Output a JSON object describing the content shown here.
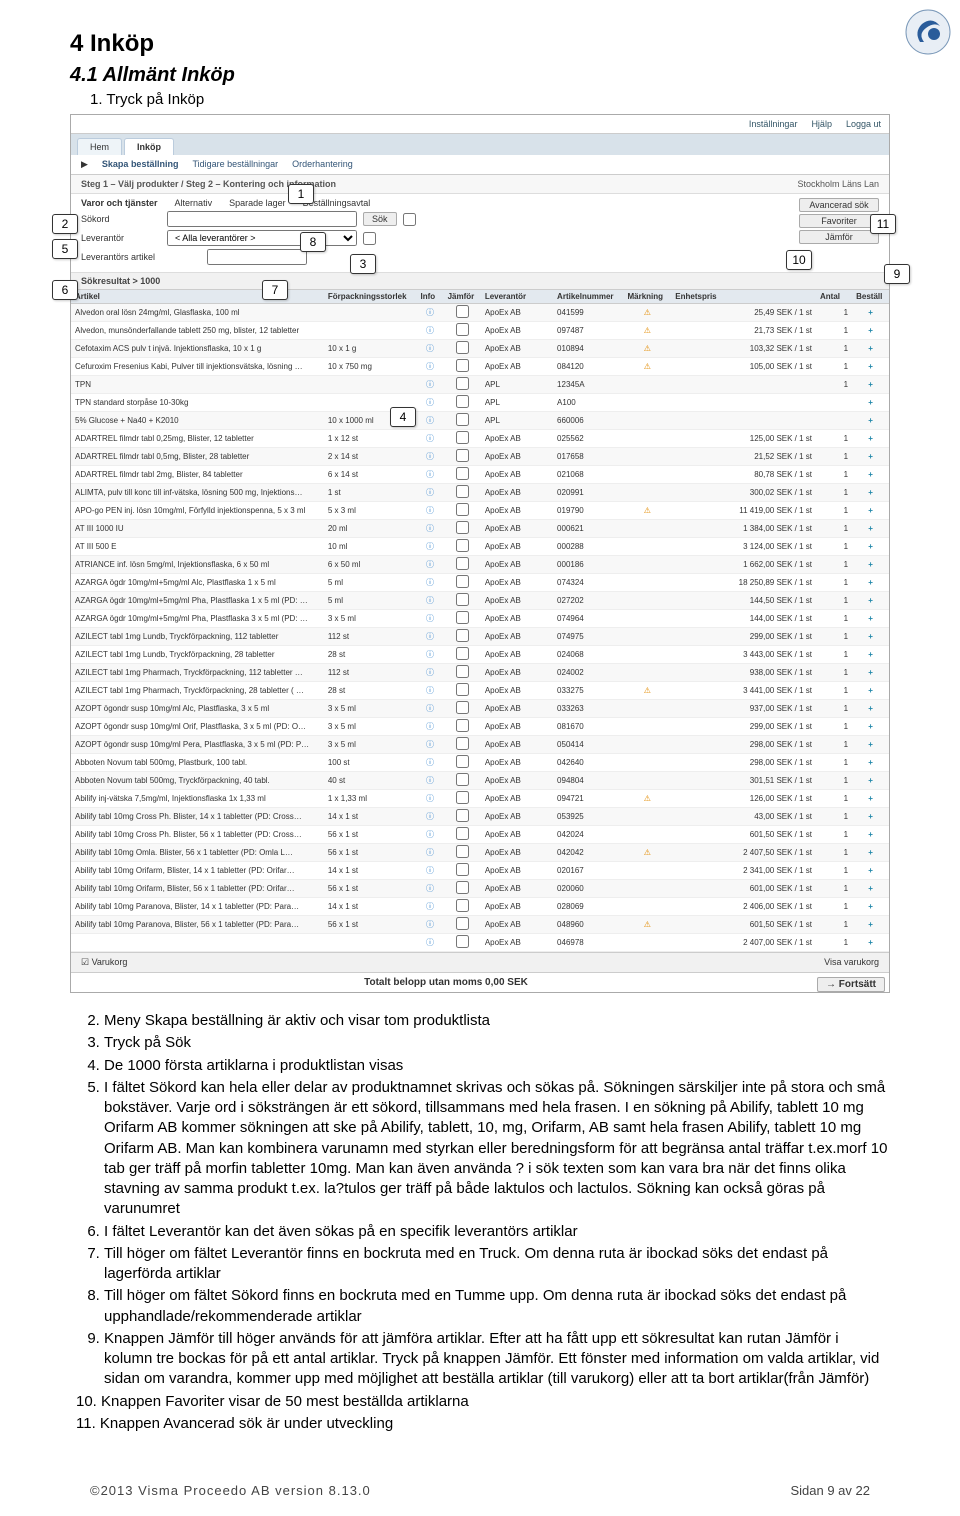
{
  "logo_color": "#2a5c9a",
  "heading": "4  Inköp",
  "subheading": "4.1  Allmänt Inköp",
  "intro": "1.  Tryck på Inköp",
  "callouts": [
    "1",
    "2",
    "3",
    "4",
    "5",
    "6",
    "7",
    "8",
    "9",
    "10",
    "11"
  ],
  "topbar": {
    "settings": "Inställningar",
    "help": "Hjälp",
    "logout": "Logga ut"
  },
  "tabs": {
    "hem": "Hem",
    "inkop": "Inköp"
  },
  "subtabs": {
    "skapa": "Skapa beställning",
    "tidigare": "Tidigare beställningar",
    "order": "Orderhantering"
  },
  "steps": "Steg 1 – Välj produkter / Steg 2 – Kontering och information",
  "rightpanel": {
    "region": "Stockholm Läns Lan",
    "adv": "Avancerad sök",
    "fav": "Favoriter",
    "cmp": "Jämför"
  },
  "filters": {
    "goods_label": "Varor och tjänster",
    "alt_label": "Alternativ",
    "spar_label": "Sparade lager",
    "best_label": "Beställningsavtal",
    "sokord_label": "Sökord",
    "sok_btn": "Sök",
    "lev_label": "Leverantör",
    "lev_value": "< Alla leverantörer >",
    "lev_art": "Leverantörs artikel"
  },
  "result_caption": "Sökresultat > 1000",
  "columns": {
    "art": "Artikel",
    "pack": "Förpackningsstorlek",
    "info": "Info",
    "cmp": "Jämför",
    "lev": "Leverantör",
    "num": "Artikelnummer",
    "mark": "Märkning",
    "unit": "Enhetspris",
    "price": "",
    "qty": "Antal",
    "add": "Beställ"
  },
  "rows": [
    {
      "art": "Alvedon oral lösn 24mg/ml, Glasflaska, 100 ml",
      "pack": "",
      "lev": "ApoEx AB",
      "num": "041599",
      "mark": "w",
      "price": "25,49 SEK / 1 st",
      "qty": "1"
    },
    {
      "art": "Alvedon, munsönderfallande tablett 250 mg, blister, 12 tabletter",
      "pack": "",
      "lev": "ApoEx AB",
      "num": "097487",
      "mark": "w",
      "price": "21,73 SEK / 1 st",
      "qty": "1"
    },
    {
      "art": "Cefotaxim ACS pulv t injvä. Injektionsflaska, 10 x 1 g",
      "pack": "10 x 1 g",
      "lev": "ApoEx AB",
      "num": "010894",
      "mark": "w",
      "price": "103,32 SEK / 1 st",
      "qty": "1"
    },
    {
      "art": "Cefuroxim Fresenius Kabi, Pulver till injektionsvätska, lösning …",
      "pack": "10 x 750 mg",
      "lev": "ApoEx AB",
      "num": "084120",
      "mark": "w",
      "price": "105,00 SEK / 1 st",
      "qty": "1"
    },
    {
      "art": "TPN",
      "pack": "",
      "lev": "APL",
      "num": "12345A",
      "mark": "",
      "price": "",
      "qty": "1"
    },
    {
      "art": "TPN standard storpåse 10-30kg",
      "pack": "",
      "lev": "APL",
      "num": "A100",
      "mark": "",
      "price": "",
      "qty": ""
    },
    {
      "art": "5% Glucose + Na40 + K2010",
      "pack": "10 x 1000 ml",
      "lev": "APL",
      "num": "660006",
      "mark": "",
      "price": "",
      "qty": ""
    },
    {
      "art": "ADARTREL filmdr tabl 0,25mg, Blister, 12 tabletter",
      "pack": "1 x 12 st",
      "lev": "ApoEx AB",
      "num": "025562",
      "mark": "",
      "price": "125,00 SEK / 1 st",
      "qty": "1"
    },
    {
      "art": "ADARTREL filmdr tabl 0,5mg, Blister, 28 tabletter",
      "pack": "2 x 14 st",
      "lev": "ApoEx AB",
      "num": "017658",
      "mark": "",
      "price": "21,52 SEK / 1 st",
      "qty": "1"
    },
    {
      "art": "ADARTREL filmdr tabl 2mg, Blister, 84 tabletter",
      "pack": "6 x 14 st",
      "lev": "ApoEx AB",
      "num": "021068",
      "mark": "",
      "price": "80,78 SEK / 1 st",
      "qty": "1"
    },
    {
      "art": "ALIMTA, pulv till konc till inf-vätska, lösning 500 mg, Injektions…",
      "pack": "1 st",
      "lev": "ApoEx AB",
      "num": "020991",
      "mark": "",
      "price": "300,02 SEK / 1 st",
      "qty": "1"
    },
    {
      "art": "APO-go PEN inj. lösn 10mg/ml, Förfylld injektionspenna, 5 x 3 ml",
      "pack": "5 x 3 ml",
      "lev": "ApoEx AB",
      "num": "019790",
      "mark": "w",
      "price": "11 419,00 SEK / 1 st",
      "qty": "1"
    },
    {
      "art": "AT III 1000 IU",
      "pack": "20 ml",
      "lev": "ApoEx AB",
      "num": "000621",
      "mark": "",
      "price": "1 384,00 SEK / 1 st",
      "qty": "1"
    },
    {
      "art": "AT III 500 E",
      "pack": "10 ml",
      "lev": "ApoEx AB",
      "num": "000288",
      "mark": "",
      "price": "3 124,00 SEK / 1 st",
      "qty": "1"
    },
    {
      "art": "ATRIANCE inf. lösn 5mg/ml, Injektionsflaska, 6 x 50 ml",
      "pack": "6 x 50 ml",
      "lev": "ApoEx AB",
      "num": "000186",
      "mark": "",
      "price": "1 662,00 SEK / 1 st",
      "qty": "1"
    },
    {
      "art": "AZARGA ögdr 10mg/ml+5mg/ml Alc, Plastflaska 1 x 5 ml",
      "pack": "5 ml",
      "lev": "ApoEx AB",
      "num": "074324",
      "mark": "",
      "price": "18 250,89 SEK / 1 st",
      "qty": "1"
    },
    {
      "art": "AZARGA ögdr 10mg/ml+5mg/ml Pha, Plastflaska 1 x 5 ml (PD: …",
      "pack": "5 ml",
      "lev": "ApoEx AB",
      "num": "027202",
      "mark": "",
      "price": "144,50 SEK / 1 st",
      "qty": "1"
    },
    {
      "art": "AZARGA ögdr 10mg/ml+5mg/ml Pha, Plastflaska 3 x 5 ml (PD: …",
      "pack": "3 x 5 ml",
      "lev": "ApoEx AB",
      "num": "074964",
      "mark": "",
      "price": "144,00 SEK / 1 st",
      "qty": "1"
    },
    {
      "art": "AZILECT tabl 1mg Lundb, Tryckförpackning, 112 tabletter",
      "pack": "112 st",
      "lev": "ApoEx AB",
      "num": "074975",
      "mark": "",
      "price": "299,00 SEK / 1 st",
      "qty": "1"
    },
    {
      "art": "AZILECT tabl 1mg Lundb, Tryckförpackning, 28 tabletter",
      "pack": "28 st",
      "lev": "ApoEx AB",
      "num": "024068",
      "mark": "",
      "price": "3 443,00 SEK / 1 st",
      "qty": "1"
    },
    {
      "art": "AZILECT tabl 1mg Pharmach, Tryckförpackning, 112 tabletter …",
      "pack": "112 st",
      "lev": "ApoEx AB",
      "num": "024002",
      "mark": "",
      "price": "938,00 SEK / 1 st",
      "qty": "1"
    },
    {
      "art": "AZILECT tabl 1mg Pharmach, Tryckförpackning, 28 tabletter ( …",
      "pack": "28 st",
      "lev": "ApoEx AB",
      "num": "033275",
      "mark": "w",
      "price": "3 441,00 SEK / 1 st",
      "qty": "1"
    },
    {
      "art": "AZOPT ögondr susp 10mg/ml Alc, Plastflaska, 3 x 5 ml",
      "pack": "3 x 5 ml",
      "lev": "ApoEx AB",
      "num": "033263",
      "mark": "",
      "price": "937,00 SEK / 1 st",
      "qty": "1"
    },
    {
      "art": "AZOPT ögondr susp 10mg/ml Orif, Plastflaska, 3 x 5 ml (PD: O…",
      "pack": "3 x 5 ml",
      "lev": "ApoEx AB",
      "num": "081670",
      "mark": "",
      "price": "299,00 SEK / 1 st",
      "qty": "1"
    },
    {
      "art": "AZOPT ögondr susp 10mg/ml Pera, Plastflaska, 3 x 5 ml (PD: P…",
      "pack": "3 x 5 ml",
      "lev": "ApoEx AB",
      "num": "050414",
      "mark": "",
      "price": "298,00 SEK / 1 st",
      "qty": "1"
    },
    {
      "art": "Abboten Novum tabl 500mg, Plastburk, 100 tabl.",
      "pack": "100 st",
      "lev": "ApoEx AB",
      "num": "042640",
      "mark": "",
      "price": "298,00 SEK / 1 st",
      "qty": "1"
    },
    {
      "art": "Abboten Novum tabl 500mg, Tryckförpackning, 40 tabl.",
      "pack": "40 st",
      "lev": "ApoEx AB",
      "num": "094804",
      "mark": "",
      "price": "301,51 SEK / 1 st",
      "qty": "1"
    },
    {
      "art": "Abilify inj-vätska 7,5mg/ml, Injektionsflaska 1x 1,33 ml",
      "pack": "1 x 1,33 ml",
      "lev": "ApoEx AB",
      "num": "094721",
      "mark": "w",
      "price": "126,00 SEK / 1 st",
      "qty": "1"
    },
    {
      "art": "Abilify tabl 10mg Cross Ph. Blister, 14 x 1 tabletter (PD: Cross…",
      "pack": "14 x 1 st",
      "lev": "ApoEx AB",
      "num": "053925",
      "mark": "",
      "price": "43,00 SEK / 1 st",
      "qty": "1"
    },
    {
      "art": "Abilify tabl 10mg Cross Ph. Blister, 56 x 1 tabletter (PD: Cross…",
      "pack": "56 x 1 st",
      "lev": "ApoEx AB",
      "num": "042024",
      "mark": "",
      "price": "601,50 SEK / 1 st",
      "qty": "1"
    },
    {
      "art": "Abilify tabl 10mg Omla. Blister, 56 x 1 tabletter (PD: Omla L…",
      "pack": "56 x 1 st",
      "lev": "ApoEx AB",
      "num": "042042",
      "mark": "w",
      "price": "2 407,50 SEK / 1 st",
      "qty": "1"
    },
    {
      "art": "Abilify tabl 10mg Orifarm, Blister, 14 x 1 tabletter (PD: Orifar…",
      "pack": "14 x 1 st",
      "lev": "ApoEx AB",
      "num": "020167",
      "mark": "",
      "price": "2 341,00 SEK / 1 st",
      "qty": "1"
    },
    {
      "art": "Abilify tabl 10mg Orifarm, Blister, 56 x 1 tabletter (PD: Orifar…",
      "pack": "56 x 1 st",
      "lev": "ApoEx AB",
      "num": "020060",
      "mark": "",
      "price": "601,00 SEK / 1 st",
      "qty": "1"
    },
    {
      "art": "Abilify tabl 10mg Paranova, Blister, 14 x 1 tabletter (PD: Para…",
      "pack": "14 x 1 st",
      "lev": "ApoEx AB",
      "num": "028069",
      "mark": "",
      "price": "2 406,00 SEK / 1 st",
      "qty": "1"
    },
    {
      "art": "Abilify tabl 10mg Paranova, Blister, 56 x 1 tabletter (PD: Para…",
      "pack": "56 x 1 st",
      "lev": "ApoEx AB",
      "num": "048960",
      "mark": "w",
      "price": "601,50 SEK / 1 st",
      "qty": "1"
    },
    {
      "art": "",
      "pack": "",
      "lev": "ApoEx AB",
      "num": "046978",
      "mark": "",
      "price": "2 407,00 SEK / 1 st",
      "qty": "1"
    }
  ],
  "bottombar": {
    "cart": "Varukorg",
    "show": "Visa varukorg",
    "total": "Totalt belopp utan moms  0,00 SEK",
    "cont": "Fortsätt"
  },
  "points": {
    "p2": "Meny Skapa beställning är aktiv och visar tom produktlista",
    "p3": "Tryck på Sök",
    "p4": "De 1000 första artiklarna i produktlistan visas",
    "p5": "I fältet Sökord kan hela eller delar av produktnamnet skrivas och sökas på. Sökningen särskiljer inte på stora och små bokstäver. Varje ord i söksträngen är ett sökord, tillsammans med hela frasen. I en sökning på Abilify, tablett 10 mg Orifarm AB kommer sökningen att ske på Abilify, tablett, 10, mg, Orifarm, AB samt hela frasen Abilify, tablett 10 mg Orifarm AB. Man kan kombinera varunamn med styrkan eller beredningsform för att begränsa antal träffar t.ex.morf 10 tab ger träff på morfin tabletter 10mg. Man kan även använda ? i sök texten som kan vara bra när det finns olika stavning av samma produkt t.ex. la?tulos ger träff på både laktulos och lactulos. Sökning kan också göras på varunumret",
    "p6": "I fältet Leverantör kan det även sökas på en specifik leverantörs artiklar",
    "p7": "Till höger om fältet Leverantör finns en bockruta med en Truck. Om denna ruta är ibockad söks det endast på lagerförda artiklar",
    "p8": "Till höger om fältet Sökord finns en bockruta med en Tumme upp. Om denna ruta är ibockad söks det endast på upphandlade/rekommenderade artiklar",
    "p9": "Knappen Jämför till höger används för att jämföra artiklar. Efter att ha fått upp ett sökresultat kan rutan Jämför i kolumn tre bockas för på ett antal artiklar. Tryck på knappen Jämför. Ett fönster med information om valda artiklar, vid sidan om varandra, kommer upp med möjlighet att beställa artiklar (till varukorg) eller att ta bort artiklar(från Jämför)",
    "p10": "Knappen Favoriter visar de 50 mest beställda artiklarna",
    "p11": "Knappen Avancerad sök är under utveckling"
  },
  "footer": {
    "left": "©2013 Visma Proceedo AB version 8.13.0",
    "right": "Sidan 9 av 22"
  }
}
